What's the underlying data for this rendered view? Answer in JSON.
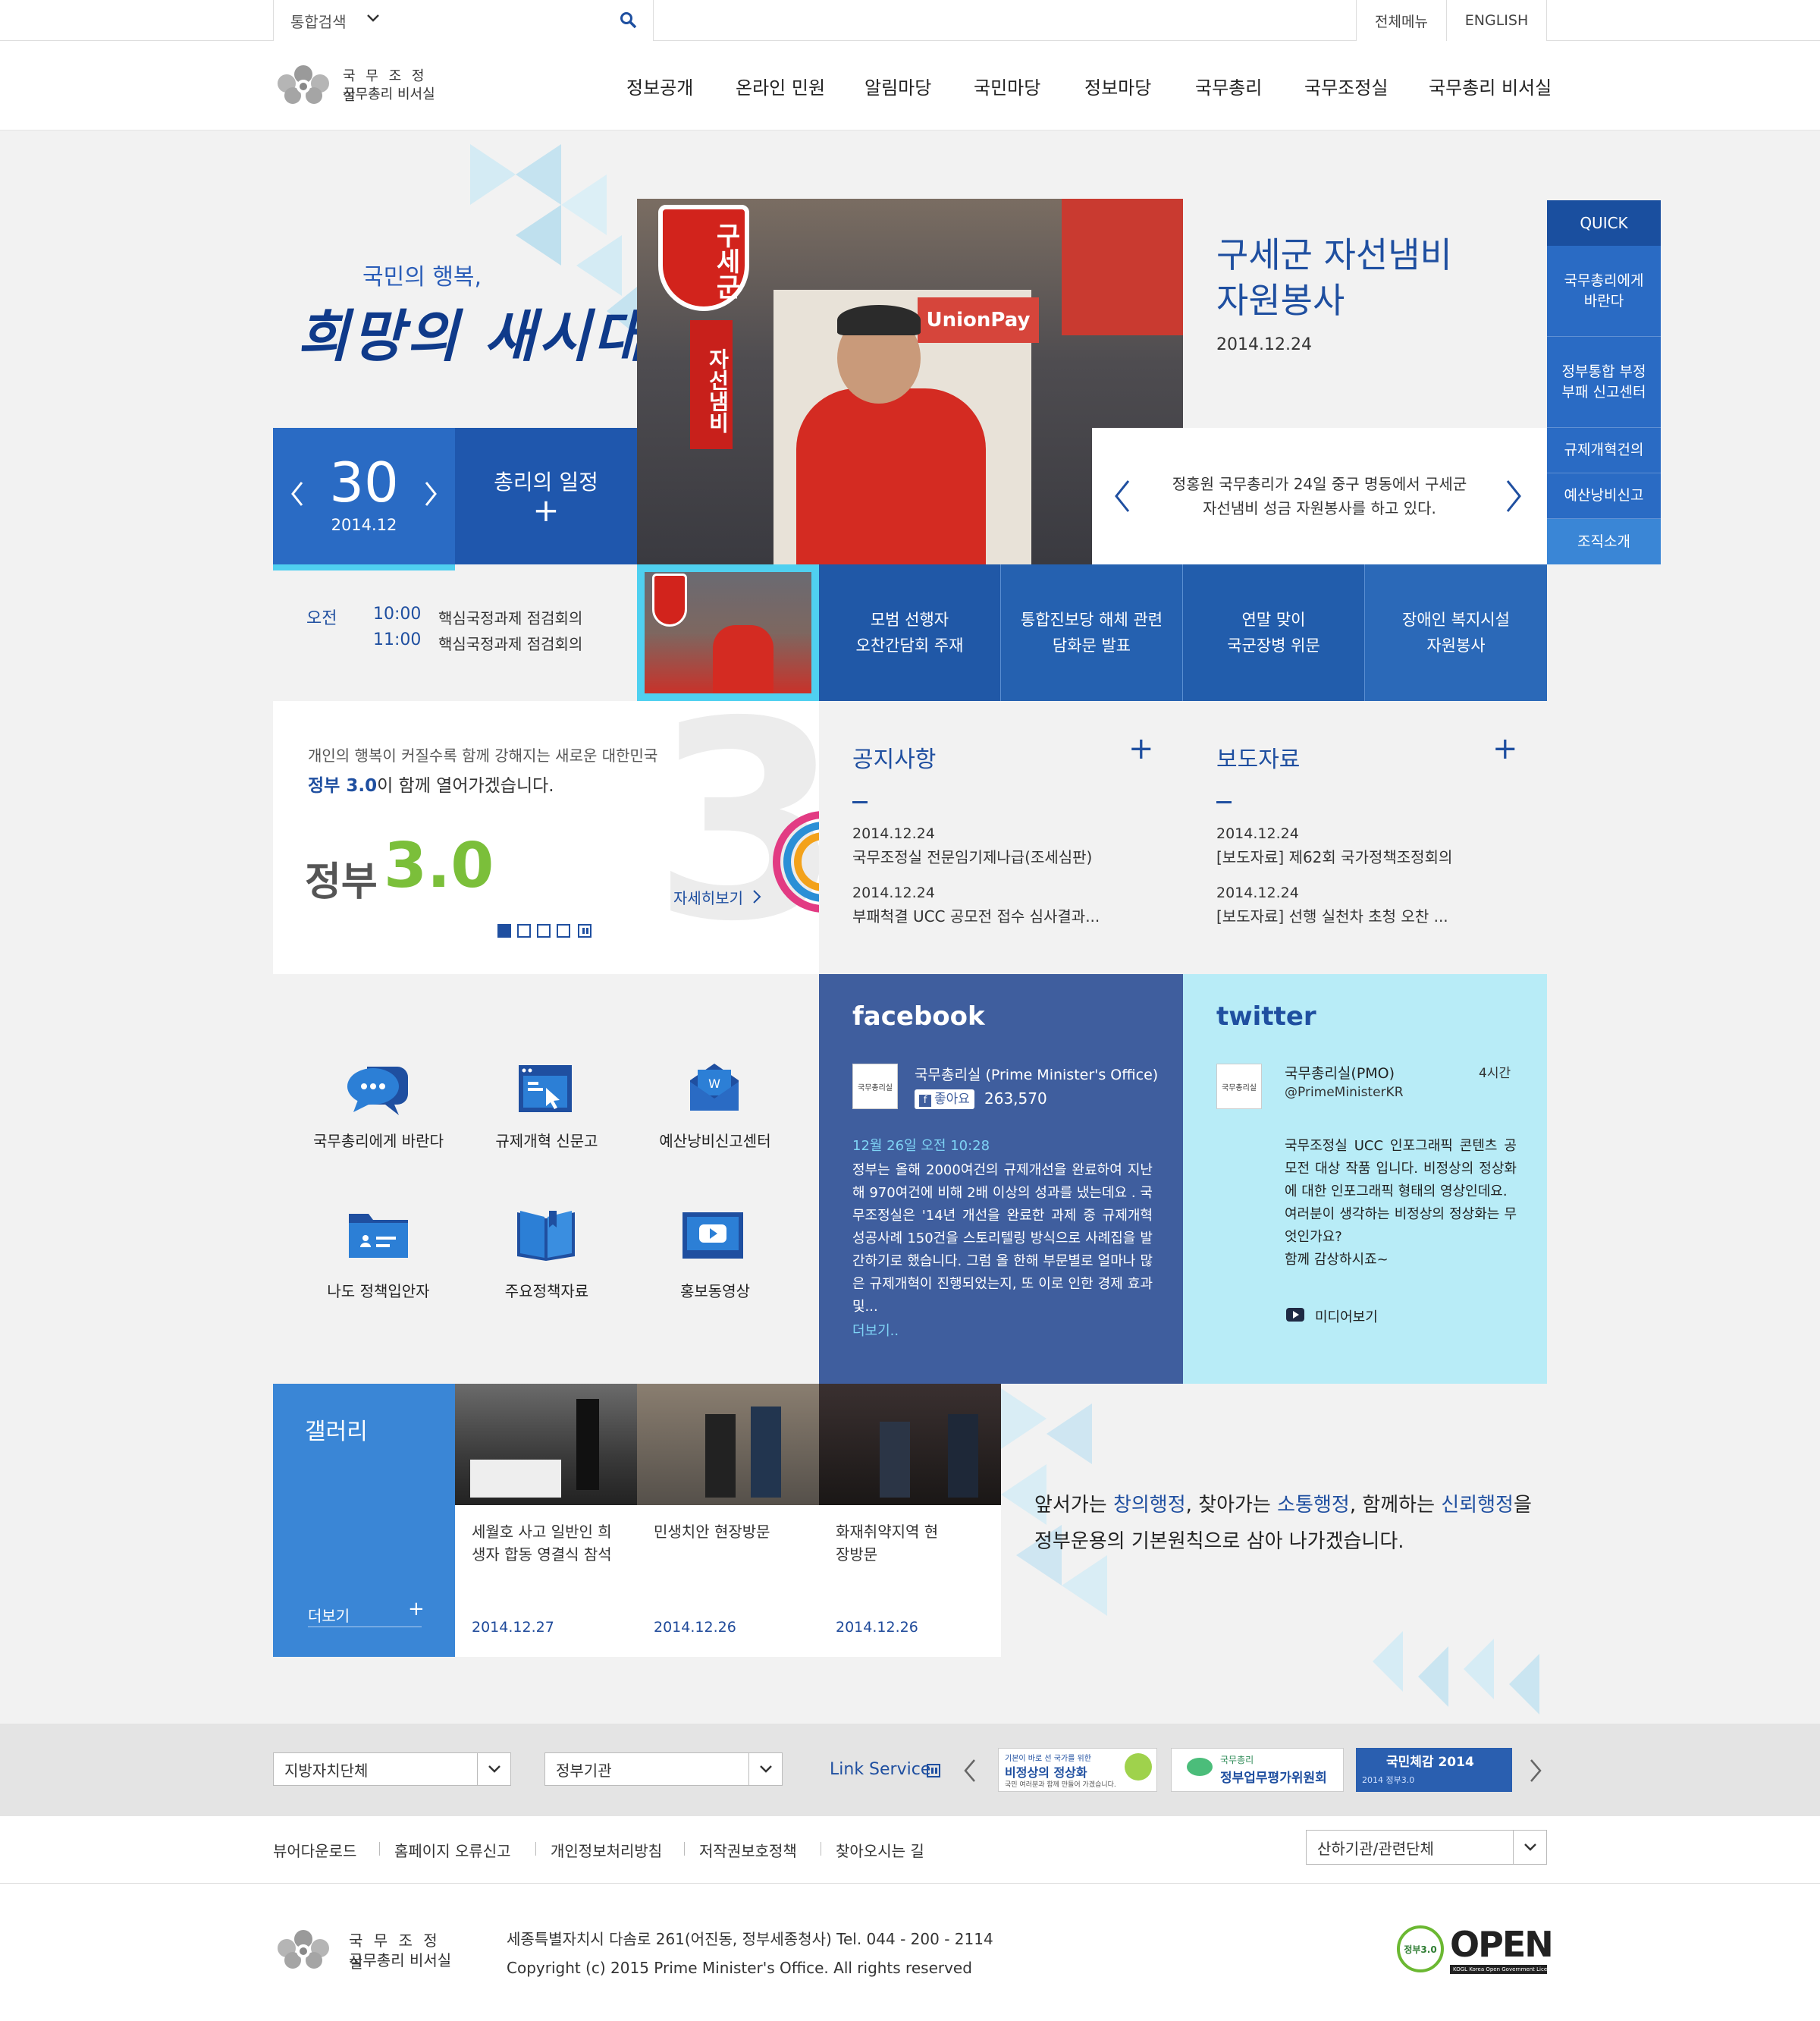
{
  "topbar": {
    "search_scope": "통합검색",
    "all_menu": "전체메뉴",
    "english": "ENGLISH"
  },
  "logo": {
    "line1": "국 무 조 정 실",
    "line2": "국무총리 비서실"
  },
  "nav": [
    "정보공개",
    "온라인 민원",
    "알림마당",
    "국민마당",
    "정보마당",
    "국무총리",
    "국무조정실",
    "국무총리 비서실"
  ],
  "slogan": {
    "small": "국민의 행복,",
    "big": "희망의 새시대"
  },
  "calendar": {
    "day": "30",
    "month": "2014.12",
    "schedule_label": "총리의 일정",
    "plus": "+"
  },
  "schedule": {
    "period": "오전",
    "items": [
      {
        "time": "10:00",
        "text": "핵심국정과제 점검회의"
      },
      {
        "time": "11:00",
        "text": "핵심국정과제 점검회의"
      }
    ]
  },
  "hero": {
    "title_line1": "구세군 자선냄비",
    "title_line2": "자원봉사",
    "date": "2014.12.24",
    "caption_line1": "정홍원 국무총리가 24일 중구 명동에서 구세군",
    "caption_line2": "자선냄비 성금 자원봉사를 하고 있다.",
    "kettle_sign": "구세군",
    "kettle_banner": "자선냄비"
  },
  "thumbs": [
    {
      "line1": "모범 선행자",
      "line2": "오찬간담회 주재"
    },
    {
      "line1": "통합진보당 해체 관련",
      "line2": "담화문 발표"
    },
    {
      "line1": "연말 맞이",
      "line2": "국군장병 위문"
    },
    {
      "line1": "장애인 복지시설",
      "line2": "자원봉사"
    }
  ],
  "quick": {
    "title": "QUICK",
    "items": [
      "국무총리에게 바란다",
      "정부통합 부정 부패 신고센터",
      "규제개혁건의",
      "예산낭비신고",
      "조직소개"
    ]
  },
  "gov30": {
    "line1": "개인의 행복이 커질수록 함께 강해지는 새로운 대한민국",
    "line2_pre": "정부 3.0",
    "line2_post": "이 함께 열어가겠습니다.",
    "logo_text": "정부",
    "logo_num": "3.0",
    "more": "자세히보기"
  },
  "notice": {
    "title": "공지사항",
    "plus": "+",
    "items": [
      {
        "date": "2014.12.24",
        "title": "국무조정실 전문임기제나급(조세심판)"
      },
      {
        "date": "2014.12.24",
        "title": "부패척결 UCC 공모전 접수 심사결과..."
      }
    ]
  },
  "press": {
    "title": "보도자료",
    "plus": "+",
    "items": [
      {
        "date": "2014.12.24",
        "title": "[보도자료] 제62회 국가정책조정회의"
      },
      {
        "date": "2014.12.24",
        "title": "[보도자료] 선행 실천차 초청 오찬 ..."
      }
    ]
  },
  "icons": [
    {
      "icon": "speech-bubble-icon",
      "label": "국무총리에게 바란다"
    },
    {
      "icon": "browser-cursor-icon",
      "label": "규제개혁 신문고"
    },
    {
      "icon": "envelope-icon",
      "label": "예산낭비신고센터"
    },
    {
      "icon": "folder-icon",
      "label": "나도 정책입안자"
    },
    {
      "icon": "book-icon",
      "label": "주요정책자료"
    },
    {
      "icon": "play-video-icon",
      "label": "홍보동영상"
    }
  ],
  "facebook": {
    "brand": "facebook",
    "account": "국무총리실 (Prime Minister's Office)",
    "like": "좋아요",
    "likes": "263,570",
    "avatar_text": "국무총리실",
    "post_time": "12월 26일 오전 10:28",
    "body": "정부는 올해 2000여건의 규제개선을 완료하여 지난해 970여건에 비해 2배 이상의 성과를 냈는데요 . 국무조정실은 '14년 개선을 완료한 과제 중 규제개혁 성공사례 150건을 스토리텔링 방식으로 사례집을 발간하기로 했습니다. 그럼 올 한해 부문별로 얼마나 많은 규제개혁이 진행되었는지, 또 이로 인한 경제 효과 및...",
    "more": "더보기.."
  },
  "twitter": {
    "brand": "twitter",
    "account": "국무총리실(PMO)",
    "handle": "@PrimeMinisterKR",
    "time": "4시간",
    "avatar_text": "국무총리실",
    "body": "국무조정실 UCC 인포그래픽 콘텐츠 공모전 대상 작품 입니다. 비정상의 정상화에 대한 인포그래픽 형태의 영상인데요.",
    "body2": "여러분이 생각하는 비정상의 정상화는 무엇인가요?",
    "body3": "함께 감상하시죠~",
    "media": "미디어보기"
  },
  "gallery": {
    "title": "갤러리",
    "more": "더보기",
    "plus": "+",
    "items": [
      {
        "caption": "세월호 사고 일반인 희생자 합동 영결식 참석",
        "date": "2014.12.27"
      },
      {
        "caption": "민생치안 현장방문",
        "date": "2014.12.26"
      },
      {
        "caption": "화재취약지역 현장방문",
        "date": "2014.12.26"
      }
    ]
  },
  "motto": {
    "p1": "앞서가는 ",
    "k1": "창의행정",
    ",": ", 찾아가는 ",
    "k2": "소통행정",
    "p3": ", 함께하는 ",
    "k3": "신뢰행정",
    "p4": "을",
    "line2": "정부운용의 기본원칙으로 삼아 나가겠습니다."
  },
  "linkbar": {
    "select1": "지방자치단체",
    "select2": "정부기관",
    "link_service": "Link Service",
    "banners": [
      {
        "title": "비정상의 정상화",
        "sub": "기본이 바로 선 국가를 위한",
        "sub2": "국민 여러분과 함께 만들어 가겠습니다."
      },
      {
        "title": "정부업무평가위원회",
        "sub": "국무총리"
      },
      {
        "title": "국민체감 2014",
        "sub": "2014 정부3.0"
      }
    ]
  },
  "footer": {
    "links": [
      "뷰어다운로드",
      "홈페이지 오류신고",
      "개인정보처리방침",
      "저작권보호정책",
      "찾아오시는 길"
    ],
    "select": "산하기관/관련단체",
    "address": "세종특별자치시 다솜로 261(어진동, 정부세종청사)  Tel. 044 - 200 - 2114",
    "copyright": "Copyright (c) 2015 Prime Minister's Office. All rights reserved",
    "open": "OPEN",
    "open_sub": "KOGL  Korea Open Government License",
    "badge": "정부3.0"
  },
  "colors": {
    "blue": "#2a6bc4",
    "dark_blue": "#1f4f9e",
    "cyan": "#4fd0f0",
    "facebook": "#3f5e9e",
    "twitter": "#b8ecf7",
    "text": "#222222"
  }
}
